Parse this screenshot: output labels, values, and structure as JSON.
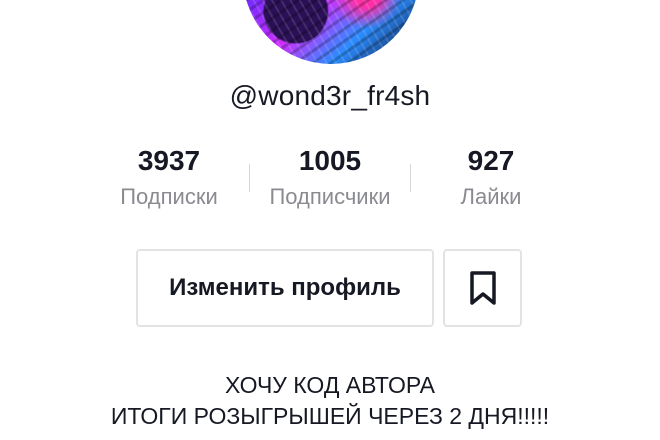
{
  "profile": {
    "username": "@wond3r_fr4sh"
  },
  "stats": [
    {
      "value": "3937",
      "label": "Подписки"
    },
    {
      "value": "1005",
      "label": "Подписчики"
    },
    {
      "value": "927",
      "label": "Лайки"
    }
  ],
  "actions": {
    "edit_profile_label": "Изменить профиль",
    "bookmark_icon": "bookmark-icon"
  },
  "bio": {
    "line1": "ХОЧУ КОД АВТОРА",
    "line2": "ИТОГИ РОЗЫГРЫШЕЙ ЧЕРЕЗ 2 ДНЯ!!!!!"
  },
  "colors": {
    "text": "#161823",
    "muted": "#8a8b91",
    "border": "#e3e3e4"
  }
}
